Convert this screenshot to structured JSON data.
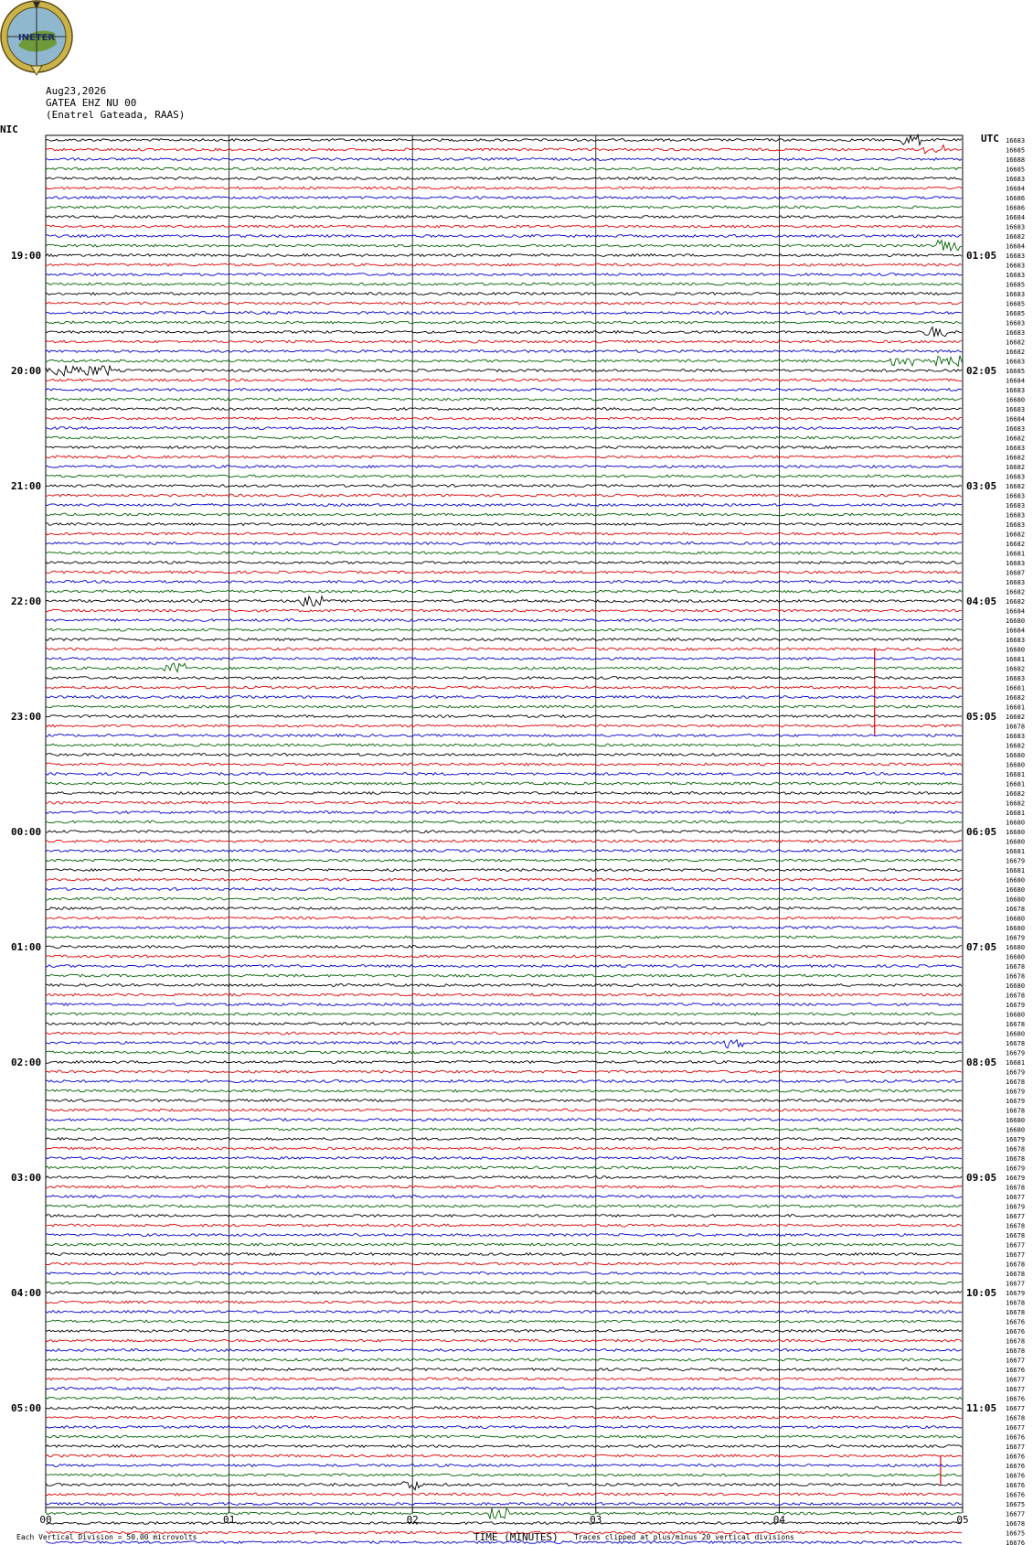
{
  "header": {
    "date": "Aug23,2026",
    "station": "GATEA EHZ NU 00",
    "location": "(Enatrel Gateada, RAAS)",
    "logo_text": "INETER",
    "left_zone": "NIC",
    "right_zone": "UTC"
  },
  "footer": {
    "scale_note": "Each Vertical Division =   50.00 microvolts",
    "xlabel": "TIME (MINUTES)",
    "clip_note": "Traces clipped at plus/minus 20 vertical divisions"
  },
  "colors": {
    "black": "#000000",
    "red": "#e00000",
    "blue": "#0000d0",
    "green": "#006400",
    "grid": "#000000"
  },
  "chart_data": {
    "type": "line",
    "xlabel": "TIME (MINUTES)",
    "xlim": [
      0,
      5
    ],
    "x_ticks": [
      "00",
      "01",
      "02",
      "03",
      "04",
      "05"
    ],
    "trace_count": 148,
    "trace_colors": [
      "black",
      "red",
      "blue",
      "green"
    ],
    "left_time_labels": [
      "19:00",
      "20:00",
      "21:00",
      "22:00",
      "23:00",
      "00:00",
      "01:00",
      "02:00",
      "03:00",
      "04:00",
      "05:00"
    ],
    "right_time_labels": [
      "01:05",
      "02:05",
      "03:05",
      "04:05",
      "05:05",
      "06:05",
      "07:05",
      "08:05",
      "09:05",
      "10:05",
      "11:05"
    ],
    "trace_values": [
      "16683",
      "16685",
      "16688",
      "16685",
      "16683",
      "16684",
      "16686",
      "16686",
      "16684",
      "16683",
      "16682",
      "16684",
      "16683",
      "16683",
      "16683",
      "16685",
      "16683",
      "16685",
      "16685",
      "16683",
      "16683",
      "16682",
      "16682",
      "16683",
      "16685",
      "16684",
      "16683",
      "16680",
      "16683",
      "16684",
      "16683",
      "16682",
      "16683",
      "16682",
      "16682",
      "16683",
      "16682",
      "16683",
      "16683",
      "16683",
      "16683",
      "16682",
      "16682",
      "16681",
      "16683",
      "16687",
      "16683",
      "16682",
      "16682",
      "16684",
      "16680",
      "16684",
      "16683",
      "16680",
      "16681",
      "16682",
      "16683",
      "16681",
      "16682",
      "16681",
      "16682",
      "16678",
      "16683",
      "16682",
      "16680",
      "16680",
      "16681",
      "16681",
      "16682",
      "16682",
      "16681",
      "16680",
      "16680",
      "16680",
      "16681",
      "16679",
      "16681",
      "16680",
      "16680",
      "16680",
      "16678",
      "16680",
      "16680",
      "16679",
      "16680",
      "16680",
      "16678",
      "16678",
      "16680",
      "16678",
      "16679",
      "16680",
      "16678",
      "16680",
      "16678",
      "16679",
      "16681",
      "16679",
      "16678",
      "16679",
      "16679",
      "16678",
      "16680",
      "16680",
      "16679",
      "16678",
      "16678",
      "16679",
      "16679",
      "16678",
      "16677",
      "16679",
      "16677",
      "16678",
      "16678",
      "16677",
      "16677",
      "16678",
      "16678",
      "16677",
      "16679",
      "16678",
      "16678",
      "16676",
      "16676",
      "16678",
      "16678",
      "16677",
      "16676",
      "16677",
      "16677",
      "16676",
      "16677",
      "16678",
      "16677",
      "16676",
      "16677",
      "16676",
      "16676",
      "16676",
      "16676",
      "16676",
      "16675",
      "16677",
      "16678",
      "16675",
      "16676",
      "16675"
    ],
    "events": [
      {
        "trace": 0,
        "x_min": 4.72,
        "note": "small spike"
      },
      {
        "trace": 1,
        "x_min": 4.84,
        "note": "small spike"
      },
      {
        "trace": 11,
        "x_min": 4.92,
        "note": "small spike"
      },
      {
        "trace": 20,
        "x_min": 4.85,
        "note": "small spike"
      },
      {
        "trace": 23,
        "x_min": 4.6,
        "x_end": 5.0,
        "note": "burst"
      },
      {
        "trace": 24,
        "x_min": 0.0,
        "x_end": 0.35,
        "note": "noise"
      },
      {
        "trace": 48,
        "x_min": 1.45,
        "note": "small event"
      },
      {
        "trace": 53,
        "x_min": 4.52,
        "x_end_trace": 62,
        "note": "vertical glitch"
      },
      {
        "trace": 55,
        "x_min": 0.7,
        "note": "small spike"
      },
      {
        "trace": 94,
        "x_min": 3.75,
        "note": "small event"
      },
      {
        "trace": 137,
        "x_min": 4.88,
        "x_end_trace": 140,
        "note": "spike"
      },
      {
        "trace": 140,
        "x_min": 2.0,
        "note": "event"
      },
      {
        "trace": 143,
        "x_min": 2.47,
        "note": "event"
      }
    ]
  }
}
